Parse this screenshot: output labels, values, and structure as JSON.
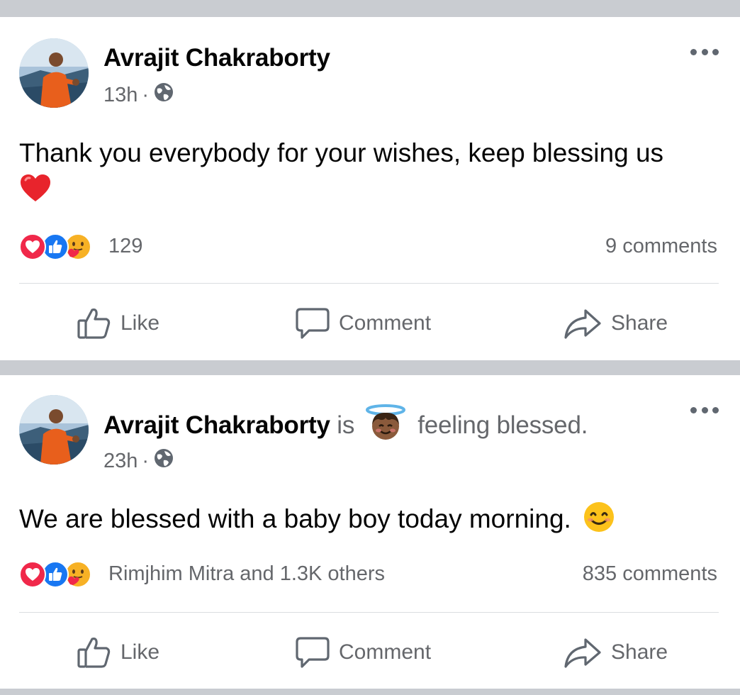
{
  "posts": [
    {
      "author": "Avrajit Chakraborty",
      "time": "13h",
      "separator": "·",
      "privacy_icon": "globe-icon",
      "text": "Thank you everybody for your wishes, keep blessing us",
      "text_emoji": "heart",
      "reactions": [
        "love",
        "like",
        "care"
      ],
      "reaction_summary": "129",
      "comments": "9 comments",
      "actions": {
        "like": "Like",
        "comment": "Comment",
        "share": "Share"
      }
    },
    {
      "author": "Avrajit Chakraborty",
      "is_word": "is",
      "feeling_emoji": "innocent-face",
      "feeling": "feeling blessed.",
      "time": "23h",
      "separator": "·",
      "privacy_icon": "globe-icon",
      "text": "We are blessed with a baby boy today morning.",
      "text_emoji": "smiling-face",
      "reactions": [
        "love",
        "like",
        "care"
      ],
      "reaction_summary": "Rimjhim Mitra and 1.3K others",
      "comments": "835 comments",
      "actions": {
        "like": "Like",
        "comment": "Comment",
        "share": "Share"
      }
    }
  ],
  "colors": {
    "feed_background": "#c9ccd1",
    "like_blue": "#1877f2",
    "love_red": "#f0284a",
    "care_yellow": "#f7b125",
    "secondary_text": "#65676b"
  }
}
